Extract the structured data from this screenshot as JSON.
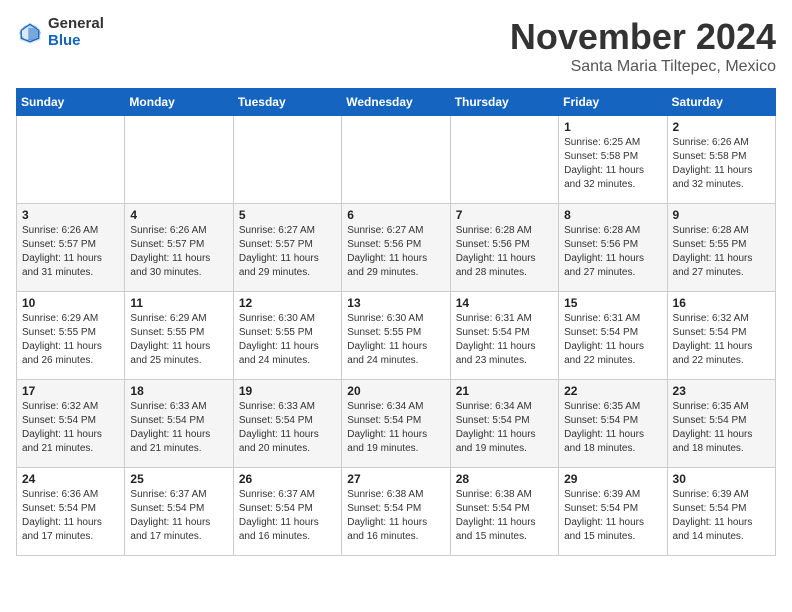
{
  "header": {
    "logo_general": "General",
    "logo_blue": "Blue",
    "month_title": "November 2024",
    "subtitle": "Santa Maria Tiltepec, Mexico"
  },
  "days_of_week": [
    "Sunday",
    "Monday",
    "Tuesday",
    "Wednesday",
    "Thursday",
    "Friday",
    "Saturday"
  ],
  "weeks": [
    [
      {
        "day": "",
        "info": ""
      },
      {
        "day": "",
        "info": ""
      },
      {
        "day": "",
        "info": ""
      },
      {
        "day": "",
        "info": ""
      },
      {
        "day": "",
        "info": ""
      },
      {
        "day": "1",
        "info": "Sunrise: 6:25 AM\nSunset: 5:58 PM\nDaylight: 11 hours and 32 minutes."
      },
      {
        "day": "2",
        "info": "Sunrise: 6:26 AM\nSunset: 5:58 PM\nDaylight: 11 hours and 32 minutes."
      }
    ],
    [
      {
        "day": "3",
        "info": "Sunrise: 6:26 AM\nSunset: 5:57 PM\nDaylight: 11 hours and 31 minutes."
      },
      {
        "day": "4",
        "info": "Sunrise: 6:26 AM\nSunset: 5:57 PM\nDaylight: 11 hours and 30 minutes."
      },
      {
        "day": "5",
        "info": "Sunrise: 6:27 AM\nSunset: 5:57 PM\nDaylight: 11 hours and 29 minutes."
      },
      {
        "day": "6",
        "info": "Sunrise: 6:27 AM\nSunset: 5:56 PM\nDaylight: 11 hours and 29 minutes."
      },
      {
        "day": "7",
        "info": "Sunrise: 6:28 AM\nSunset: 5:56 PM\nDaylight: 11 hours and 28 minutes."
      },
      {
        "day": "8",
        "info": "Sunrise: 6:28 AM\nSunset: 5:56 PM\nDaylight: 11 hours and 27 minutes."
      },
      {
        "day": "9",
        "info": "Sunrise: 6:28 AM\nSunset: 5:55 PM\nDaylight: 11 hours and 27 minutes."
      }
    ],
    [
      {
        "day": "10",
        "info": "Sunrise: 6:29 AM\nSunset: 5:55 PM\nDaylight: 11 hours and 26 minutes."
      },
      {
        "day": "11",
        "info": "Sunrise: 6:29 AM\nSunset: 5:55 PM\nDaylight: 11 hours and 25 minutes."
      },
      {
        "day": "12",
        "info": "Sunrise: 6:30 AM\nSunset: 5:55 PM\nDaylight: 11 hours and 24 minutes."
      },
      {
        "day": "13",
        "info": "Sunrise: 6:30 AM\nSunset: 5:55 PM\nDaylight: 11 hours and 24 minutes."
      },
      {
        "day": "14",
        "info": "Sunrise: 6:31 AM\nSunset: 5:54 PM\nDaylight: 11 hours and 23 minutes."
      },
      {
        "day": "15",
        "info": "Sunrise: 6:31 AM\nSunset: 5:54 PM\nDaylight: 11 hours and 22 minutes."
      },
      {
        "day": "16",
        "info": "Sunrise: 6:32 AM\nSunset: 5:54 PM\nDaylight: 11 hours and 22 minutes."
      }
    ],
    [
      {
        "day": "17",
        "info": "Sunrise: 6:32 AM\nSunset: 5:54 PM\nDaylight: 11 hours and 21 minutes."
      },
      {
        "day": "18",
        "info": "Sunrise: 6:33 AM\nSunset: 5:54 PM\nDaylight: 11 hours and 21 minutes."
      },
      {
        "day": "19",
        "info": "Sunrise: 6:33 AM\nSunset: 5:54 PM\nDaylight: 11 hours and 20 minutes."
      },
      {
        "day": "20",
        "info": "Sunrise: 6:34 AM\nSunset: 5:54 PM\nDaylight: 11 hours and 19 minutes."
      },
      {
        "day": "21",
        "info": "Sunrise: 6:34 AM\nSunset: 5:54 PM\nDaylight: 11 hours and 19 minutes."
      },
      {
        "day": "22",
        "info": "Sunrise: 6:35 AM\nSunset: 5:54 PM\nDaylight: 11 hours and 18 minutes."
      },
      {
        "day": "23",
        "info": "Sunrise: 6:35 AM\nSunset: 5:54 PM\nDaylight: 11 hours and 18 minutes."
      }
    ],
    [
      {
        "day": "24",
        "info": "Sunrise: 6:36 AM\nSunset: 5:54 PM\nDaylight: 11 hours and 17 minutes."
      },
      {
        "day": "25",
        "info": "Sunrise: 6:37 AM\nSunset: 5:54 PM\nDaylight: 11 hours and 17 minutes."
      },
      {
        "day": "26",
        "info": "Sunrise: 6:37 AM\nSunset: 5:54 PM\nDaylight: 11 hours and 16 minutes."
      },
      {
        "day": "27",
        "info": "Sunrise: 6:38 AM\nSunset: 5:54 PM\nDaylight: 11 hours and 16 minutes."
      },
      {
        "day": "28",
        "info": "Sunrise: 6:38 AM\nSunset: 5:54 PM\nDaylight: 11 hours and 15 minutes."
      },
      {
        "day": "29",
        "info": "Sunrise: 6:39 AM\nSunset: 5:54 PM\nDaylight: 11 hours and 15 minutes."
      },
      {
        "day": "30",
        "info": "Sunrise: 6:39 AM\nSunset: 5:54 PM\nDaylight: 11 hours and 14 minutes."
      }
    ]
  ]
}
